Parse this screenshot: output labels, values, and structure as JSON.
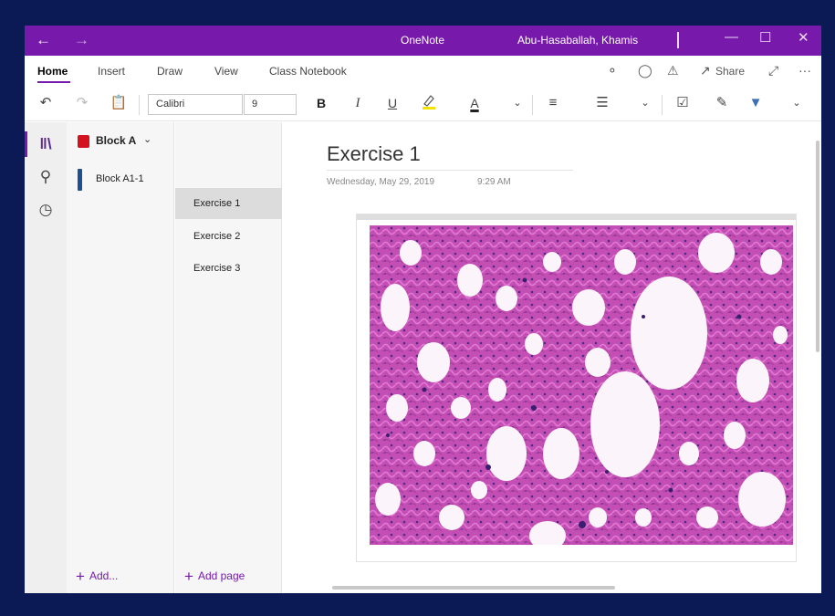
{
  "titlebar": {
    "back_icon": "arrow-left-icon",
    "forward_icon": "arrow-right-icon",
    "app_title": "OneNote",
    "user_name": "Abu-Hasaballah, Khamis",
    "minimize_icon": "minimize-icon",
    "maximize_icon": "maximize-icon",
    "close_icon": "close-icon"
  },
  "ribbon": {
    "tabs": [
      "Home",
      "Insert",
      "Draw",
      "View",
      "Class Notebook"
    ],
    "active_tab": "Home",
    "share_label": "Share",
    "more_label": "···"
  },
  "toolbar": {
    "font_name": "Calibri",
    "font_size": "9",
    "bold_label": "B",
    "italic_label": "I",
    "underline_label": "U",
    "font_color_label": "A"
  },
  "notebook": {
    "name": "Block A",
    "sections": [
      {
        "label": "Block A1-1",
        "color": "#1e4f91"
      }
    ],
    "add_section_label": "Add..."
  },
  "pages": {
    "items": [
      {
        "label": "Exercise 1",
        "selected": true
      },
      {
        "label": "Exercise 2",
        "selected": false
      },
      {
        "label": "Exercise 3",
        "selected": false
      }
    ],
    "add_page_label": "Add page"
  },
  "page": {
    "title": "Exercise 1",
    "date": "Wednesday, May 29, 2019",
    "time": "9:29 AM"
  },
  "colors": {
    "accent": "#7719aa",
    "notebook_icon": "#d4111f",
    "background": "#0b1a55"
  }
}
